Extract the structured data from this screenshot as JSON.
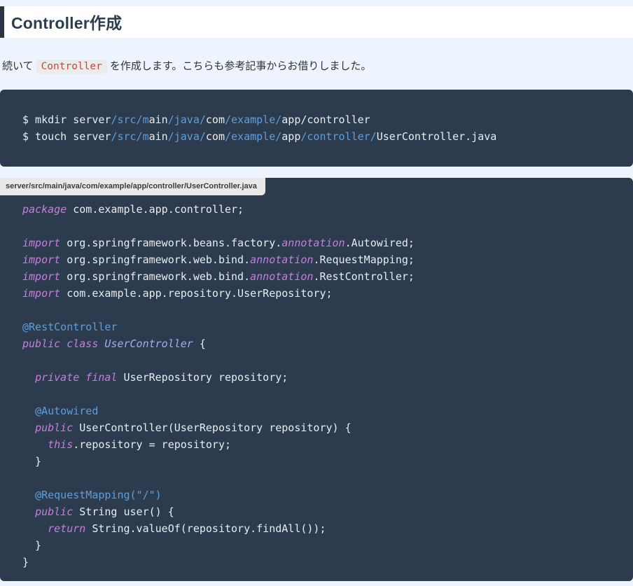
{
  "article": {
    "heading": "Controller作成",
    "paragraph": {
      "before": "続いて",
      "inline_code": "Controller",
      "after": "を作成します。こちらも参考記事からお借りしました。"
    },
    "shell_block": {
      "lines": [
        [
          {
            "s": "p",
            "t": "$ mkdir server"
          },
          {
            "s": "b",
            "t": "/src/m"
          },
          {
            "s": "p",
            "t": "ain"
          },
          {
            "s": "b",
            "t": "/java/"
          },
          {
            "s": "p",
            "t": "com"
          },
          {
            "s": "b",
            "t": "/example/"
          },
          {
            "s": "p",
            "t": "app/controller"
          }
        ],
        [
          {
            "s": "p",
            "t": "$ touch server"
          },
          {
            "s": "b",
            "t": "/src/m"
          },
          {
            "s": "p",
            "t": "ain"
          },
          {
            "s": "b",
            "t": "/java/"
          },
          {
            "s": "p",
            "t": "com"
          },
          {
            "s": "b",
            "t": "/example/"
          },
          {
            "s": "p",
            "t": "app"
          },
          {
            "s": "b",
            "t": "/controller/"
          },
          {
            "s": "p",
            "t": "UserController.java"
          }
        ]
      ]
    },
    "code_block": {
      "filename": "server/src/main/java/com/example/app/controller/UserController.java",
      "lines": [
        [
          {
            "s": "k",
            "t": "package"
          },
          {
            "s": "p",
            "t": " com.example.app.controller;"
          }
        ],
        [],
        [
          {
            "s": "k",
            "t": "import"
          },
          {
            "s": "p",
            "t": " org.springframework.beans.factory."
          },
          {
            "s": "k",
            "t": "annotation"
          },
          {
            "s": "p",
            "t": ".Autowired;"
          }
        ],
        [
          {
            "s": "k",
            "t": "import"
          },
          {
            "s": "p",
            "t": " org.springframework.web.bind."
          },
          {
            "s": "k",
            "t": "annotation"
          },
          {
            "s": "p",
            "t": ".RequestMapping;"
          }
        ],
        [
          {
            "s": "k",
            "t": "import"
          },
          {
            "s": "p",
            "t": " org.springframework.web.bind."
          },
          {
            "s": "k",
            "t": "annotation"
          },
          {
            "s": "p",
            "t": ".RestController;"
          }
        ],
        [
          {
            "s": "k",
            "t": "import"
          },
          {
            "s": "p",
            "t": " com.example.app.repository.UserRepository;"
          }
        ],
        [],
        [
          {
            "s": "m",
            "t": "@RestController"
          }
        ],
        [
          {
            "s": "k",
            "t": "public class"
          },
          {
            "s": "p",
            "t": " "
          },
          {
            "s": "c",
            "t": "UserController"
          },
          {
            "s": "p",
            "t": " {"
          }
        ],
        [],
        [
          {
            "s": "p",
            "t": "  "
          },
          {
            "s": "k",
            "t": "private final"
          },
          {
            "s": "p",
            "t": " UserRepository repository;"
          }
        ],
        [],
        [
          {
            "s": "p",
            "t": "  "
          },
          {
            "s": "m",
            "t": "@Autowired"
          }
        ],
        [
          {
            "s": "p",
            "t": "  "
          },
          {
            "s": "k",
            "t": "public"
          },
          {
            "s": "p",
            "t": " UserController(UserRepository repository) {"
          }
        ],
        [
          {
            "s": "p",
            "t": "    "
          },
          {
            "s": "k",
            "t": "this"
          },
          {
            "s": "p",
            "t": ".repository = repository;"
          }
        ],
        [
          {
            "s": "p",
            "t": "  }"
          }
        ],
        [],
        [
          {
            "s": "p",
            "t": "  "
          },
          {
            "s": "m",
            "t": "@RequestMapping(\"/\")"
          }
        ],
        [
          {
            "s": "p",
            "t": "  "
          },
          {
            "s": "k",
            "t": "public"
          },
          {
            "s": "p",
            "t": " String user() {"
          }
        ],
        [
          {
            "s": "p",
            "t": "    "
          },
          {
            "s": "k",
            "t": "return"
          },
          {
            "s": "p",
            "t": " String.valueOf(repository.findAll());"
          }
        ],
        [
          {
            "s": "p",
            "t": "  }"
          }
        ],
        [
          {
            "s": "p",
            "t": "}"
          }
        ]
      ]
    },
    "colors": {
      "page_bg": "#edf4fe",
      "code_bg": "#2d3b4e",
      "code_fg": "#e9ecf1",
      "keyword_purple": "#c47fdc",
      "annotation_blue": "#5d9edb",
      "class_name_lavender": "#a4adee",
      "inline_code_fg": "#bc4b42",
      "inline_code_bg": "#ececec",
      "heading_fg": "#2c3d4f",
      "heading_bar": "#2a3644",
      "filename_tab_bg": "#e9e9e9",
      "filename_tab_fg": "#3c3c3c"
    }
  }
}
